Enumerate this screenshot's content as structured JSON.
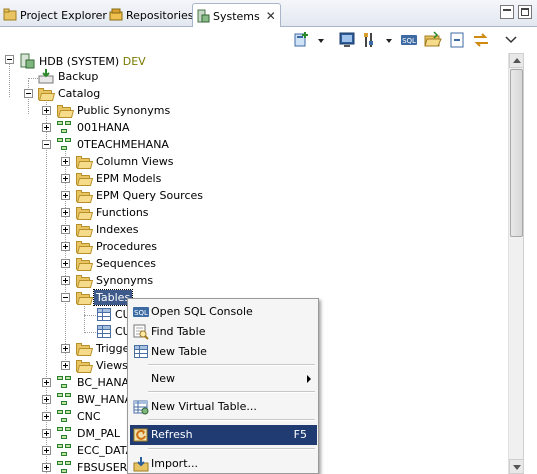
{
  "tabs": [
    {
      "label": "Project Explorer",
      "icon": "project-explorer-icon",
      "active": false
    },
    {
      "label": "Repositories",
      "icon": "repositories-icon",
      "active": false
    },
    {
      "label": "Systems",
      "icon": "systems-icon",
      "active": true
    }
  ],
  "close_glyph": "✕",
  "tree": {
    "root": {
      "label": "HDB (SYSTEM)",
      "suffix": "DEV"
    },
    "backup": "Backup",
    "catalog": "Catalog",
    "public_synonyms": "Public Synonyms",
    "schema_001hana": "001HANA",
    "schema_0teach": "0TEACHMEHANA",
    "column_views": "Column Views",
    "epm_models": "EPM Models",
    "epm_query_sources": "EPM Query Sources",
    "functions": "Functions",
    "indexes": "Indexes",
    "procedures": "Procedures",
    "sequences": "Sequences",
    "synonyms": "Synonyms",
    "tables": "Tables",
    "table_1": "CU",
    "table_2": "CU",
    "triggers": "Trigge",
    "views": "Views",
    "bc_hana": "BC_HANA",
    "bw_hana": "BW_HANA",
    "cnc": "CNC",
    "dm_pal": "DM_PAL",
    "ecc_data": "ECC_DATA",
    "fbsuser": "FBSUSER6"
  },
  "context_menu": {
    "open_sql_console": "Open SQL Console",
    "find_table": "Find Table",
    "new_table": "New Table",
    "new": "New",
    "new_virtual_table": "New Virtual Table...",
    "refresh": "Refresh",
    "refresh_shortcut": "F5",
    "import": "Import..."
  },
  "colors": {
    "selection": "#3d5a8a",
    "menu_highlight": "#1f3b72",
    "dev_tag": "#7a7a00"
  }
}
